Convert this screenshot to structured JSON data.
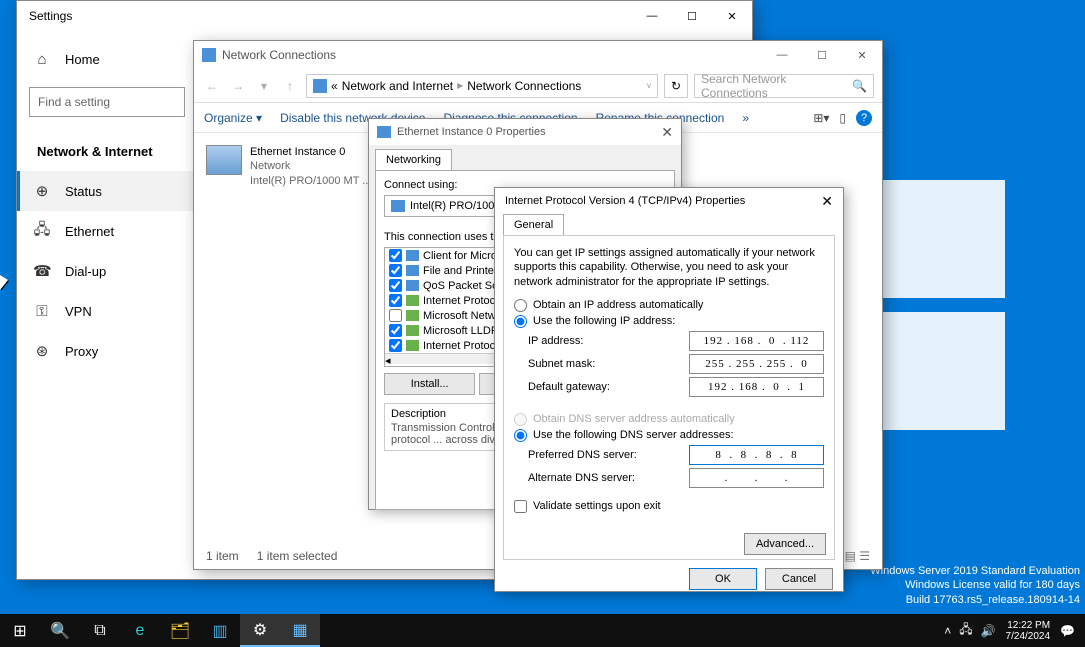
{
  "desktop": {
    "watermark_line1": "Windows Server 2019 Standard Evaluation",
    "watermark_line2": "Windows License valid for 180 days",
    "watermark_line3": "Build 17763.rs5_release.180914-14"
  },
  "taskbar": {
    "time": "12:22 PM",
    "date": "7/24/2024"
  },
  "settings": {
    "title": "Settings",
    "home": "Home",
    "search_placeholder": "Find a setting",
    "section": "Network & Internet",
    "items": [
      "Status",
      "Ethernet",
      "Dial-up",
      "VPN",
      "Proxy"
    ]
  },
  "nc": {
    "title": "Network Connections",
    "breadcrumb_pre": "«",
    "breadcrumb_1": "Network and Internet",
    "breadcrumb_2": "Network Connections",
    "search_placeholder": "Search Network Connections",
    "toolbar": {
      "organize": "Organize ▾",
      "disable": "Disable this network device",
      "diagnose": "Diagnose this connection",
      "rename": "Rename this connection",
      "more": "»"
    },
    "adapter": {
      "name": "Ethernet Instance 0",
      "status": "Network",
      "device": "Intel(R) PRO/1000 MT ..."
    },
    "status_count": "1 item",
    "status_selected": "1 item selected"
  },
  "prop": {
    "title": "Ethernet Instance 0 Properties",
    "tab": "Networking",
    "connect_label": "Connect using:",
    "connect_device": "Intel(R) PRO/1000 ...",
    "uses_label": "This connection uses the ...",
    "components": [
      {
        "checked": true,
        "icon": "b",
        "label": "Client for Microsoft ..."
      },
      {
        "checked": true,
        "icon": "b",
        "label": "File and Printer S..."
      },
      {
        "checked": true,
        "icon": "b",
        "label": "QoS Packet Sch..."
      },
      {
        "checked": true,
        "icon": "g",
        "label": "Internet Protocol ..."
      },
      {
        "checked": false,
        "icon": "g",
        "label": "Microsoft Networ..."
      },
      {
        "checked": true,
        "icon": "g",
        "label": "Microsoft LLDP ..."
      },
      {
        "checked": true,
        "icon": "g",
        "label": "Internet Protocol ..."
      }
    ],
    "install": "Install...",
    "desc_title": "Description",
    "desc_body": "Transmission Control Protocol ... wide area network protocol ... across diverse intercon..."
  },
  "ipv4": {
    "title": "Internet Protocol Version 4 (TCP/IPv4) Properties",
    "tab": "General",
    "info": "You can get IP settings assigned automatically if your network supports this capability. Otherwise, you need to ask your network administrator for the appropriate IP settings.",
    "radio_auto_ip": "Obtain an IP address automatically",
    "radio_static_ip": "Use the following IP address:",
    "ip_label": "IP address:",
    "ip_value": "192 . 168 .  0  . 112",
    "mask_label": "Subnet mask:",
    "mask_value": "255 . 255 . 255 .  0",
    "gw_label": "Default gateway:",
    "gw_value": "192 . 168 .  0  .  1",
    "radio_auto_dns": "Obtain DNS server address automatically",
    "radio_static_dns": "Use the following DNS server addresses:",
    "dns1_label": "Preferred DNS server:",
    "dns1_value": "8  .  8  .  8  .  8",
    "dns2_label": "Alternate DNS server:",
    "dns2_value": ".       .       .",
    "validate": "Validate settings upon exit",
    "advanced": "Advanced...",
    "ok": "OK",
    "cancel": "Cancel"
  }
}
